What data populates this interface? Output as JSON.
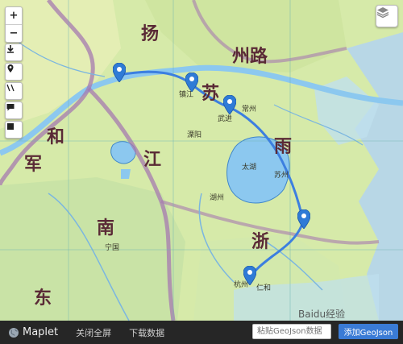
{
  "map": {
    "region_labels": [
      "州路",
      "南",
      "浙",
      "江",
      "东",
      "雨",
      "和",
      "军",
      "扬",
      "苏"
    ],
    "place_labels": [
      "杭州",
      "苏州",
      "湖州",
      "常州",
      "镇江",
      "太湖",
      "仁和",
      "宁国",
      "溧阳",
      "武进"
    ],
    "watermark": "Baidu经验"
  },
  "controls": {
    "zoom_in": "+",
    "zoom_out": "−",
    "download_icon": "download-icon",
    "locate_icon": "locate-icon",
    "measure_icon": "measure-icon",
    "comment_icon": "comment-icon",
    "stop_icon": "square-icon",
    "layers_icon": "layers-icon"
  },
  "toolbar": {
    "brand": "Maplet",
    "fullscreen": "关闭全屏",
    "download": "下载数据",
    "geojson_placeholder": "粘贴GeoJson数据",
    "add_geojson": "添加GeoJson"
  },
  "colors": {
    "route": "#3c7fe0",
    "marker": "#2f7bd6",
    "water": "#8cc8ef",
    "land": "#cfe6a8",
    "border": "#a67ab0",
    "toolbar_bg": "#262626",
    "button_blue": "#3a7bd5"
  }
}
